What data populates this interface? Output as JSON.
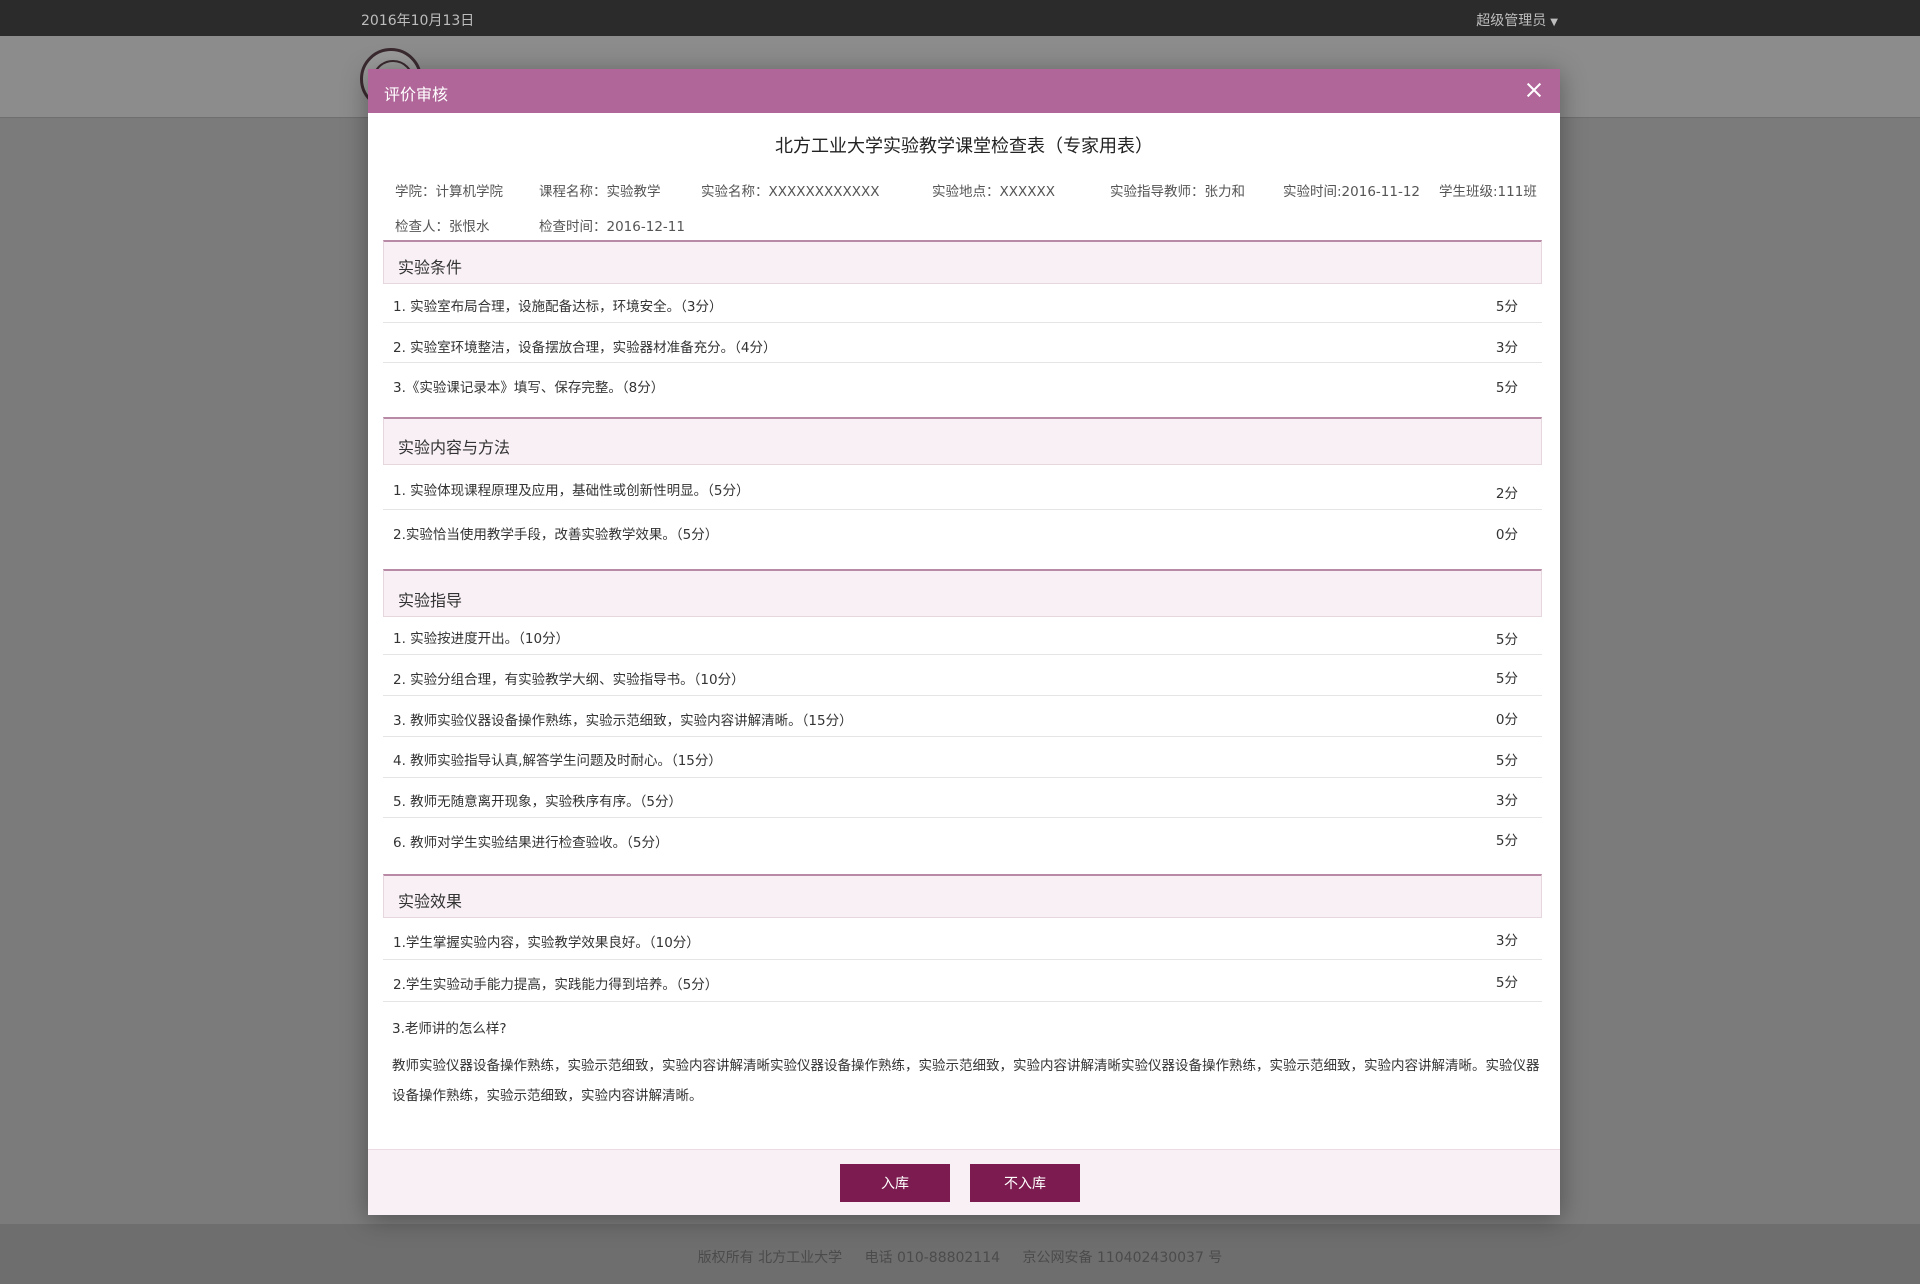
{
  "topbar": {
    "date": "2016年10月13日",
    "user": "超级管理员"
  },
  "footer": {
    "copyright": "版权所有 北方工业大学",
    "phone": "电话 010-88802114",
    "icp": "京公网安备 110402430037 号"
  },
  "modal": {
    "title": "评价审核",
    "doc_title": "北方工业大学实验教学课堂检查表（专家用表）",
    "info": {
      "college": "学院：计算机学院",
      "course": "课程名称：实验教学",
      "experiment": "实验名称：XXXXXXXXXXXX",
      "location": "实验地点：XXXXXX",
      "teacher": "实验指导教师：张力和",
      "exp_time": "实验时间:2016-11-12",
      "class": "学生班级:111班",
      "inspector": "检查人：张恨水",
      "check_time": "检查时间：2016-12-11"
    },
    "sections": [
      {
        "title": "实验条件",
        "items": [
          {
            "q": "1. 实验室布局合理，设施配备达标，环境安全。（3分）",
            "s": "5分"
          },
          {
            "q": "2. 实验室环境整洁，设备摆放合理，实验器材准备充分。（4分）",
            "s": "3分"
          },
          {
            "q": "3.《实验课记录本》填写、保存完整。（8分）",
            "s": "5分"
          }
        ]
      },
      {
        "title": "实验内容与方法",
        "items": [
          {
            "q": "1. 实验体现课程原理及应用，基础性或创新性明显。（5分）",
            "s": "2分"
          },
          {
            "q": "2.实验恰当使用教学手段，改善实验教学效果。（5分）",
            "s": "0分"
          }
        ]
      },
      {
        "title": "实验指导",
        "items": [
          {
            "q": "1. 实验按进度开出。（10分）",
            "s": "5分"
          },
          {
            "q": "2. 实验分组合理，有实验教学大纲、实验指导书。（10分）",
            "s": "5分"
          },
          {
            "q": "3. 教师实验仪器设备操作熟练，实验示范细致，实验内容讲解清晰。（15分）",
            "s": "0分"
          },
          {
            "q": "4. 教师实验指导认真,解答学生问题及时耐心。（15分）",
            "s": "5分"
          },
          {
            "q": "5. 教师无随意离开现象，实验秩序有序。（5分）",
            "s": "3分"
          },
          {
            "q": "6. 教师对学生实验结果进行检查验收。（5分）",
            "s": "5分"
          }
        ]
      },
      {
        "title": "实验效果",
        "items": [
          {
            "q": "1.学生掌握实验内容，实验教学效果良好。（10分）",
            "s": "3分"
          },
          {
            "q": "2.学生实验动手能力提高，实践能力得到培养。（5分）",
            "s": "5分"
          }
        ]
      }
    ],
    "open_question": {
      "q": "3.老师讲的怎么样?",
      "answer": "教师实验仪器设备操作熟练，实验示范细致，实验内容讲解清晰实验仪器设备操作熟练，实验示范细致，实验内容讲解清晰实验仪器设备操作熟练，实验示范细致，实验内容讲解清晰。实验仪器设备操作熟练，实验示范细致，实验内容讲解清晰。"
    },
    "buttons": {
      "store": "入库",
      "no_store": "不入库"
    }
  }
}
